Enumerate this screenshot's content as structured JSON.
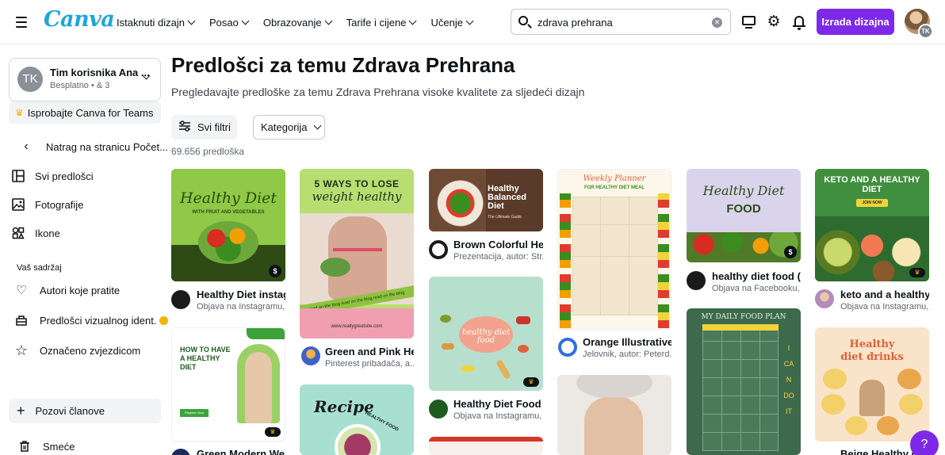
{
  "header": {
    "logo": "Canva",
    "nav": [
      "Istaknuti dizajn",
      "Posao",
      "Obrazovanje",
      "Tarife i cijene",
      "Učenje"
    ],
    "search_value": "zdrava prehrana",
    "create_label": "Izrada dizajna",
    "avatar_initials": "TK"
  },
  "sidebar": {
    "team_initials": "TK",
    "team_name": "Tim korisnika Ana ...",
    "team_sub": "Besplatno • & 3",
    "try_teams": "Isprobajte Canva for Teams",
    "back_label": "Natrag na stranicu Počet...",
    "items": [
      {
        "label": "Svi predlošci",
        "icon": "layout-icon"
      },
      {
        "label": "Fotografije",
        "icon": "image-icon"
      },
      {
        "label": "Ikone",
        "icon": "shapes-icon"
      }
    ],
    "section_label": "Vaš sadržaj",
    "content_items": [
      {
        "label": "Autori koje pratite",
        "icon": "heart-hand-icon"
      },
      {
        "label": "Predlošci vizualnog ident.",
        "icon": "brand-kit-icon"
      },
      {
        "label": "Označeno zvjezdicom",
        "icon": "star-icon"
      }
    ],
    "invite_label": "Pozovi članove",
    "trash_label": "Smeće"
  },
  "main": {
    "title": "Predlošci za temu Zdrava Prehrana",
    "subtitle": "Pregledavajte predloške za temu Zdrava Prehrana visoke kvalitete za sljedeći dizajn",
    "filters_label": "Svi filtri",
    "category_label": "Kategorija",
    "count": "69.656 predloška"
  },
  "cards": [
    {
      "id": "c1",
      "title": "Healthy Diet instag...",
      "meta": "Objava na Instagramu, ...",
      "thumb_line1": "Healthy Diet",
      "thumb_line2": "WITH FRUIT AND VEGETABLES",
      "badge": "$"
    },
    {
      "id": "c2",
      "title": "Green and Pink He...",
      "meta": "Pinterest pribadača, a...",
      "thumb_line1": "5 WAYS TO LOSE",
      "thumb_line2": "weight healthy",
      "thumb_line3": "read on the blog read on the blog read on the blog",
      "thumb_line4": "www.reallygreatsite.com"
    },
    {
      "id": "c3",
      "title": "Brown Colorful He...",
      "meta": "Prezentacija, autor: Str...",
      "thumb_line1": "Healthy Balanced Diet",
      "thumb_line2": "The Ultimate Guide"
    },
    {
      "id": "c4",
      "title": "Orange Illustrative ...",
      "meta": "Jelovnik, autor: Peterd...",
      "thumb_line1": "Weekly Planner",
      "thumb_line2": "FOR HEALTHY DIET MEAL"
    },
    {
      "id": "c5",
      "title": "healthy diet food (...",
      "meta": "Objava na Facebooku, ...",
      "thumb_line1": "Healthy Diet",
      "thumb_line2": "FOOD",
      "badge": "$"
    },
    {
      "id": "c6",
      "title": "keto and a healthy ...",
      "meta": "Objava na Instagramu, ...",
      "thumb_line1": "KETO AND A HEALTHY DIET",
      "thumb_line2": "JOIN NOW"
    },
    {
      "id": "c7",
      "title": "Green Modern Web...",
      "meta": "",
      "thumb_line1": "HOW TO HAVE A HEALTHY DIET",
      "thumb_line2": "Register Now"
    },
    {
      "id": "c8",
      "title": "Healthy Diet Food I...",
      "meta": "Objava na Instagramu, ...",
      "thumb_line1": "healthy diet food"
    },
    {
      "id": "c9",
      "title": "",
      "meta": "",
      "thumb_line1": "Recipe",
      "thumb_line2": "HEALTHY FOOD"
    },
    {
      "id": "c10",
      "title": "",
      "meta": "",
      "thumb_line1": "MY DAILY FOOD PLAN",
      "thumb_line2": "I CAN DO IT"
    },
    {
      "id": "c11",
      "title": "Beige Healthy die...",
      "meta": "",
      "thumb_line1": "Healthy diet drinks"
    }
  ],
  "help_label": "?"
}
